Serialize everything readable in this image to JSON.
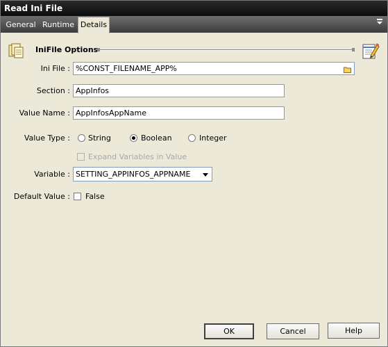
{
  "window": {
    "title": "Read Ini File"
  },
  "tabs": [
    {
      "label": "General"
    },
    {
      "label": "Runtime"
    },
    {
      "label": "Details"
    }
  ],
  "active_tab": "Details",
  "section": {
    "title": "IniFile Options",
    "icon": "ini-file-icon",
    "edit_icon": "notepad-edit-icon"
  },
  "form": {
    "ini_file": {
      "label": "Ini File :",
      "value": "%CONST_FILENAME_APP%",
      "icon": "folder-icon"
    },
    "section_field": {
      "label": "Section :",
      "value": "AppInfos"
    },
    "value_name": {
      "label": "Value Name :",
      "value": "AppInfosAppName"
    },
    "value_type": {
      "label": "Value Type :",
      "options": [
        {
          "label": "String",
          "selected": false
        },
        {
          "label": "Boolean",
          "selected": true
        },
        {
          "label": "Integer",
          "selected": false
        }
      ]
    },
    "expand_variables": {
      "label": "Expand Variables in Value",
      "checked": false,
      "enabled": false
    },
    "variable": {
      "label": "Variable :",
      "value": "SETTING_APPINFOS_APPNAME"
    },
    "default_value": {
      "label": "Default Value :",
      "checkbox_label": "False",
      "checked": false
    }
  },
  "buttons": {
    "ok": "OK",
    "cancel": "Cancel",
    "help": "Help"
  }
}
